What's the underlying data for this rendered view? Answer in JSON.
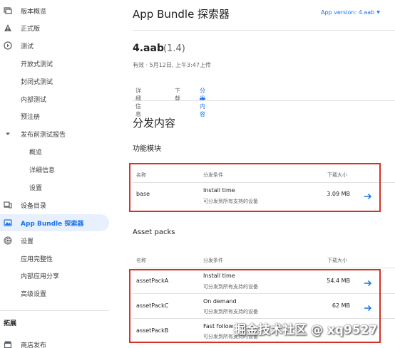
{
  "sidebar": {
    "items": [
      {
        "label": "版本概览",
        "icon": "layers-icon",
        "level": 0
      },
      {
        "label": "正式版",
        "icon": "warning-icon",
        "level": 0
      },
      {
        "label": "测试",
        "icon": "play-circle-icon",
        "level": 0
      },
      {
        "label": "开放式测试",
        "icon": "",
        "level": 1
      },
      {
        "label": "封闭式测试",
        "icon": "",
        "level": 1
      },
      {
        "label": "内部测试",
        "icon": "",
        "level": 1
      },
      {
        "label": "预注册",
        "icon": "",
        "level": 1
      },
      {
        "label": "发布前测试报告",
        "icon": "caret-down-icon",
        "level": 1
      },
      {
        "label": "概览",
        "icon": "",
        "level": 2
      },
      {
        "label": "详细信息",
        "icon": "",
        "level": 2
      },
      {
        "label": "设置",
        "icon": "",
        "level": 2
      },
      {
        "label": "设备目录",
        "icon": "devices-icon",
        "level": 0
      },
      {
        "label": "App Bundle 探索器",
        "icon": "bundle-icon",
        "level": 0,
        "active": true
      },
      {
        "label": "设置",
        "icon": "gear-icon",
        "level": 0
      },
      {
        "label": "应用完整性",
        "icon": "",
        "level": 1
      },
      {
        "label": "内部应用分享",
        "icon": "",
        "level": 1
      },
      {
        "label": "高级设置",
        "icon": "",
        "level": 1
      }
    ],
    "extension_section": "拓展",
    "store_item": {
      "label": "商店发布",
      "icon": "store-icon"
    }
  },
  "header": {
    "title": "App Bundle 探索器",
    "version_select": "App version: 4.aab",
    "caret_icon": "chevron-down-icon"
  },
  "bundle": {
    "name": "4.aab",
    "version": "(1.4)",
    "meta": "有效 · 5月12日, 上午3:47上传"
  },
  "tabs": [
    {
      "label": "详细信息"
    },
    {
      "label": "下载"
    },
    {
      "label": "分发内容",
      "active": true
    }
  ],
  "content": {
    "section_title": "分发内容",
    "features": {
      "title": "功能模块",
      "headers": {
        "name": "名称",
        "condition": "分发条件",
        "size": "下载大小"
      },
      "rows": [
        {
          "name": "base",
          "condition": "Install time",
          "condition_sub": "可分发到所有支持的设备",
          "size": "3.09 MB"
        }
      ]
    },
    "asset_packs": {
      "title": "Asset packs",
      "headers": {
        "name": "名称",
        "condition": "分发条件",
        "size": "下载大小"
      },
      "rows": [
        {
          "name": "assetPackA",
          "condition": "Install time",
          "condition_sub": "可分发到所有支持的设备",
          "size": "54.4 MB"
        },
        {
          "name": "assetPackC",
          "condition": "On demand",
          "condition_sub": "可分发到所有支持的设备",
          "size": "62 MB"
        },
        {
          "name": "assetPackB",
          "condition": "Fast follow",
          "condition_sub": "可分发到所有支持的设备",
          "size": ""
        }
      ]
    }
  },
  "watermark": "掘金技术社区 @ xq9527",
  "colors": {
    "accent": "#1a73e8",
    "highlight_box": "#d93025",
    "active_bg": "#e8f0fe"
  }
}
